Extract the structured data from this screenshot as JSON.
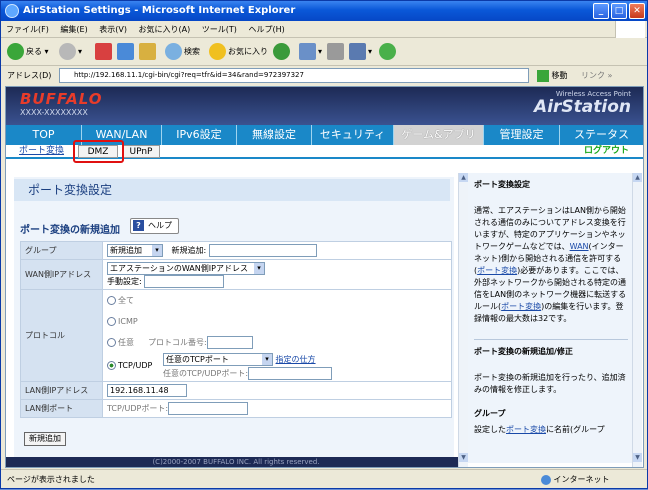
{
  "window": {
    "title": "AirStation Settings - Microsoft Internet Explorer"
  },
  "menu": [
    "ファイル(F)",
    "編集(E)",
    "表示(V)",
    "お気に入り(A)",
    "ツール(T)",
    "ヘルプ(H)"
  ],
  "toolbar": {
    "back": "戻る",
    "search": "検索",
    "favorites": "お気に入り"
  },
  "address": {
    "label": "アドレス(D)",
    "url": "http://192.168.11.1/cgi-bin/cgi?req=tfr&id=34&rand=972397327",
    "go": "移動",
    "links": "リンク"
  },
  "header": {
    "brand": "BUFFALO",
    "model": "XXXX-XXXXXXXX",
    "tagline": "Wireless Access Point",
    "product": "AirStation"
  },
  "nav": [
    "TOP",
    "WAN/LAN",
    "IPv6設定",
    "無線設定",
    "セキュリティ",
    "ゲーム&アプリ",
    "管理設定",
    "ステータス"
  ],
  "subnav": {
    "port": "ポート変換",
    "dmz": "DMZ",
    "upnp": "UPnP",
    "logout": "ログアウト"
  },
  "main": {
    "title": "ポート変換設定",
    "section": "ポート変換の新規追加",
    "help": "ヘルプ",
    "group": {
      "label": "グループ",
      "select": "新規追加",
      "new_label": "新規追加:"
    },
    "wan": {
      "label": "WAN側IPアドレス",
      "select": "エアステーションのWAN側IPアドレス",
      "manual": "手動設定:"
    },
    "protocol": {
      "label": "プロトコル",
      "all": "全て",
      "icmp": "ICMP",
      "any": "任意",
      "proto_num": "プロトコル番号:",
      "tcpudp": "TCP/UDP",
      "tcp_select": "任意のTCPポート",
      "howto": "指定の仕方",
      "port_label": "任意のTCP/UDPポート:"
    },
    "lan_ip": {
      "label": "LAN側IPアドレス",
      "value": "192.168.11.48"
    },
    "lan_port": {
      "label": "LAN側ポート",
      "port_label": "TCP/UDPポート:"
    },
    "add_button": "新規追加",
    "footer": "(C)2000-2007 BUFFALO INC. All rights reserved."
  },
  "side": {
    "h1": "ポート変換設定",
    "p1a": "通常、エアステーションはLAN側から開始される通信のみについてアドレス変換を行いますが、特定のアプリケーションやネットワークゲームなどでは、",
    "p1_wan": "WAN",
    "p1b": "(インターネット)側から開始される通信を許可する(",
    "p1_port": "ポート変換",
    "p1c": ")必要があります。ここでは、外部ネットワークから開始される特定の通信をLAN側のネットワーク機器に転送するルール(",
    "p1_port2": "ポート変換",
    "p1d": ")の編集を行います。登録情報の最大数は32です。",
    "h2": "ポート変換の新規追加/修正",
    "p2": "ポート変換の新規追加を行ったり、追加済みの情報を修正します。",
    "h3": "グループ",
    "p3a": "設定した",
    "p3_link": "ポート変換",
    "p3b": "に名前(グループ"
  },
  "status": {
    "text": "ページが表示されました",
    "zone": "インターネット"
  }
}
